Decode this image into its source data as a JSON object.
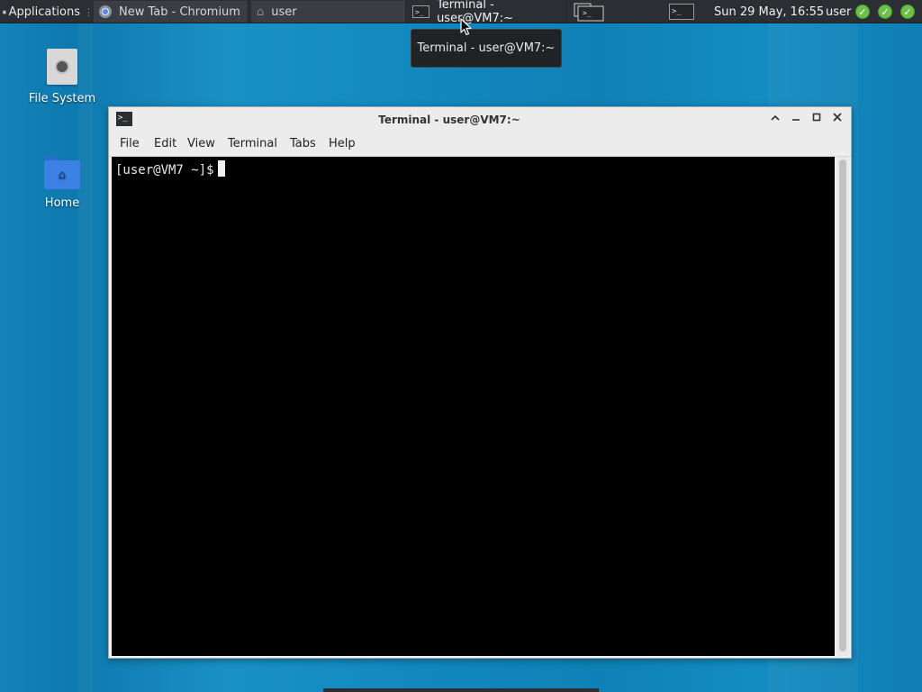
{
  "panel": {
    "applications_label": "Applications",
    "tasks": [
      {
        "label": "New Tab - Chromium",
        "icon": "chromium-icon"
      },
      {
        "label": "user",
        "icon": "home-icon"
      },
      {
        "label": "Terminal - user@VM7:~",
        "icon": "terminal-icon",
        "active": true
      }
    ],
    "clock": "Sun 29 May, 16:55",
    "user": "user"
  },
  "tooltip": "Terminal - user@VM7:~",
  "desktop": {
    "icons": [
      {
        "label": "File System",
        "icon": "drive-icon"
      },
      {
        "label": "Home",
        "icon": "home-folder-icon"
      }
    ]
  },
  "window": {
    "title": "Terminal - user@VM7:~",
    "menu": [
      "File",
      "Edit",
      "View",
      "Terminal",
      "Tabs",
      "Help"
    ],
    "prompt": "[user@VM7 ~]$"
  },
  "colors": {
    "panel_bg": "#2b2e33",
    "desktop_bg": "#1288bf",
    "terminal_bg": "#000000",
    "status_ok": "#6cc04a"
  }
}
